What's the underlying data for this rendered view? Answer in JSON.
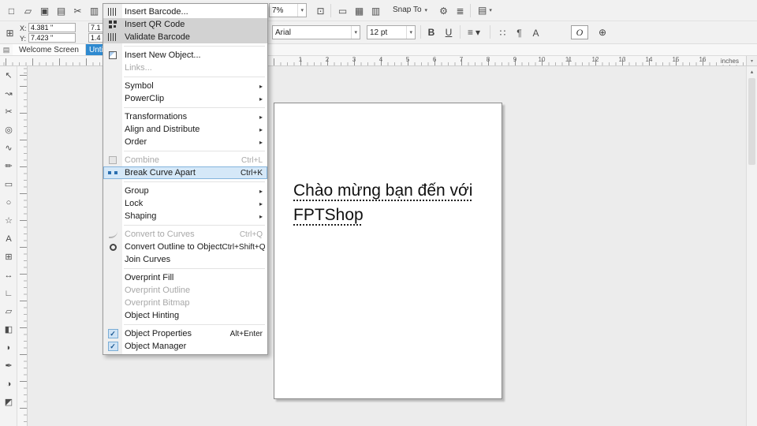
{
  "toolbar": {
    "left_icons": [
      {
        "name": "new-document-icon",
        "glyph": "□"
      },
      {
        "name": "open-icon",
        "glyph": "▱"
      },
      {
        "name": "save-icon",
        "glyph": "▣"
      },
      {
        "name": "print-icon",
        "glyph": "▤"
      },
      {
        "name": "cut-icon",
        "glyph": "✂"
      },
      {
        "name": "copy-icon",
        "glyph": "▥"
      }
    ],
    "zoom_value": "7%",
    "fullscreen_icon": {
      "name": "fullscreen-preview-icon",
      "glyph": "⊡"
    },
    "view_icons": [
      {
        "name": "show-rulers-icon",
        "glyph": "▭"
      },
      {
        "name": "show-grid-icon",
        "glyph": "▦"
      },
      {
        "name": "show-guidelines-icon",
        "glyph": "▥"
      }
    ],
    "snap_label": "Snap To",
    "after_icons": [
      {
        "name": "options-icon",
        "glyph": "⚙"
      },
      {
        "name": "application-launcher-icon",
        "glyph": "≣"
      }
    ],
    "workspace_icon": {
      "name": "workspace-icon",
      "glyph": "▤"
    },
    "caret": "▾"
  },
  "propbar": {
    "handle_icon": {
      "name": "object-position-icon",
      "glyph": "⊞"
    },
    "x_label": "X:",
    "x_value": "4.381 \"",
    "y_label": "Y:",
    "y_value": "7.423 \"",
    "width_value": "7.1",
    "height_value": "1.4",
    "font_family": "Arial",
    "font_size": "12 pt",
    "bold_label": "B",
    "underline_label": "U",
    "align_icon": {
      "name": "text-alignment-icon",
      "glyph": "≡"
    },
    "para_icons": [
      {
        "name": "bulleted-list-icon",
        "glyph": "∷"
      },
      {
        "name": "drop-cap-icon",
        "glyph": "¶"
      },
      {
        "name": "edit-text-icon",
        "glyph": "A"
      }
    ],
    "opentype_label": "O",
    "add_icon": {
      "name": "add-icon",
      "glyph": "⊕"
    },
    "caret": "▾"
  },
  "tabs": {
    "page_icon": {
      "name": "document-icon",
      "glyph": "▤"
    },
    "items": [
      {
        "label": "Welcome Screen",
        "active": false
      },
      {
        "label": "Untitl",
        "active": true
      }
    ]
  },
  "ruler": {
    "numbers": [
      "1",
      "2",
      "3",
      "4",
      "5",
      "6",
      "7",
      "8",
      "9",
      "10",
      "11",
      "12",
      "13",
      "14",
      "15",
      "16"
    ],
    "unit": "inches"
  },
  "toolbox": [
    {
      "name": "pick-tool",
      "glyph": "↖"
    },
    {
      "name": "shape-tool",
      "glyph": "↝"
    },
    {
      "name": "crop-tool",
      "glyph": "✂"
    },
    {
      "name": "zoom-tool",
      "glyph": "◎"
    },
    {
      "name": "freehand-tool",
      "glyph": "∿"
    },
    {
      "name": "artistic-media-tool",
      "glyph": "✏"
    },
    {
      "name": "rectangle-tool",
      "glyph": "▭"
    },
    {
      "name": "ellipse-tool",
      "glyph": "○"
    },
    {
      "name": "polygon-tool",
      "glyph": "☆"
    },
    {
      "name": "text-tool",
      "glyph": "A"
    },
    {
      "name": "table-tool",
      "glyph": "⊞"
    },
    {
      "name": "dimension-tool",
      "glyph": "↔"
    },
    {
      "name": "connector-tool",
      "glyph": "∟"
    },
    {
      "name": "drop-shadow-tool",
      "glyph": "▱"
    },
    {
      "name": "transparency-tool",
      "glyph": "◧"
    },
    {
      "name": "color-eyedropper-tool",
      "glyph": "◗"
    },
    {
      "name": "outline-pen-tool",
      "glyph": "✒"
    },
    {
      "name": "fill-tool",
      "glyph": "◑"
    },
    {
      "name": "interactive-fill-tool",
      "glyph": "◩"
    }
  ],
  "menu": {
    "check_glyph": "✓",
    "submenu_glyph": "▸",
    "items": [
      {
        "label": "Insert Barcode...",
        "icon": "barcode"
      },
      {
        "label": "Insert QR Code",
        "icon": "qrcode",
        "state": "gray"
      },
      {
        "label": "Validate Barcode",
        "icon": "validate",
        "state": "gray",
        "sep": true
      },
      {
        "label": "Insert New Object...",
        "icon": "newobject"
      },
      {
        "label": "Links...",
        "state": "disabled",
        "sep": true
      },
      {
        "label": "Symbol",
        "submenu": true
      },
      {
        "label": "PowerClip",
        "submenu": true,
        "sep": true
      },
      {
        "label": "Transformations",
        "submenu": true
      },
      {
        "label": "Align and Distribute",
        "submenu": true
      },
      {
        "label": "Order",
        "submenu": true,
        "sep": true
      },
      {
        "label": "Combine",
        "shortcut": "Ctrl+L",
        "state": "disabled",
        "icon": "combine"
      },
      {
        "label": "Break Curve Apart",
        "shortcut": "Ctrl+K",
        "state": "highlighted",
        "icon": "breakapart",
        "sep": true
      },
      {
        "label": "Group",
        "submenu": true
      },
      {
        "label": "Lock",
        "submenu": true
      },
      {
        "label": "Shaping",
        "submenu": true,
        "sep": true
      },
      {
        "label": "Convert to Curves",
        "shortcut": "Ctrl+Q",
        "state": "disabled",
        "icon": "tocurves"
      },
      {
        "label": "Convert Outline to Object",
        "shortcut": "Ctrl+Shift+Q",
        "icon": "outlineobj"
      },
      {
        "label": "Join Curves",
        "sep": true
      },
      {
        "label": "Overprint Fill"
      },
      {
        "label": "Overprint Outline",
        "state": "disabled"
      },
      {
        "label": "Overprint Bitmap",
        "state": "disabled"
      },
      {
        "label": "Object Hinting",
        "sep": true
      },
      {
        "label": "Object Properties",
        "shortcut": "Alt+Enter",
        "checked": true
      },
      {
        "label": "Object Manager",
        "checked": true
      }
    ]
  },
  "canvas": {
    "line1": "Chào mừng bạn đến với",
    "line2": "FPTShop"
  },
  "scrollbar": {
    "up_glyph": "▴"
  }
}
